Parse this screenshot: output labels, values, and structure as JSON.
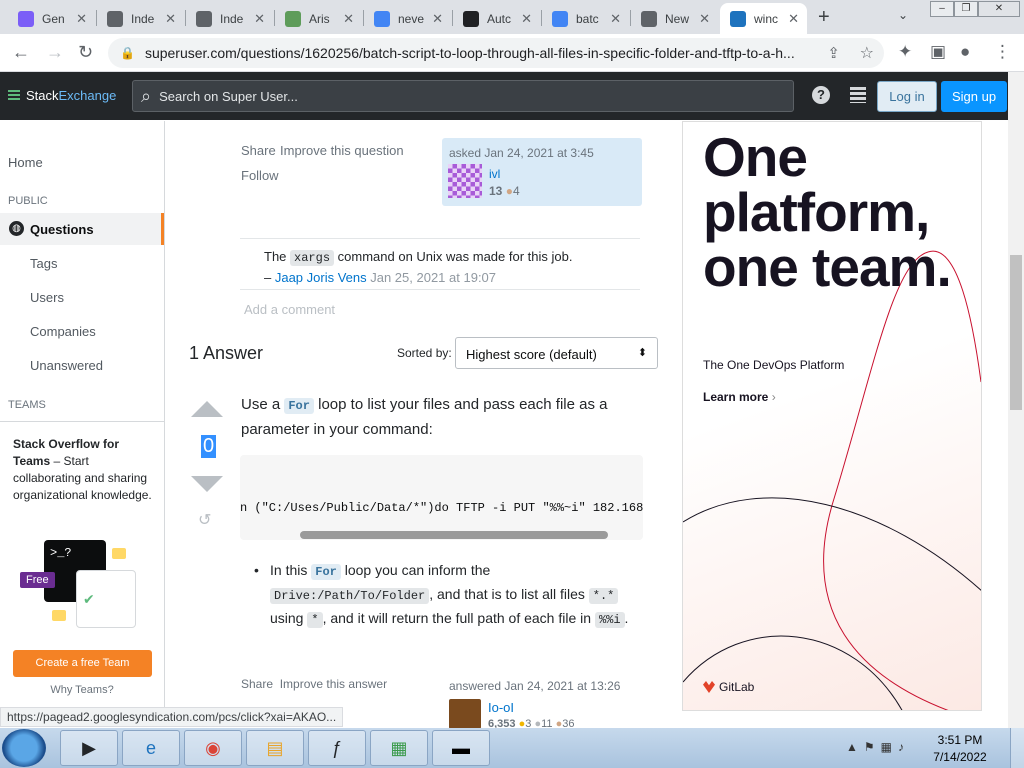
{
  "tabs": [
    {
      "title": "Gen",
      "icon": "gemini-icon",
      "color": "#7b5ef7"
    },
    {
      "title": "Inde",
      "icon": "globe-icon",
      "color": "#5f6368"
    },
    {
      "title": "Inde",
      "icon": "globe-icon",
      "color": "#5f6368"
    },
    {
      "title": "Aris",
      "icon": "leaf-icon",
      "color": "#5e9c5a"
    },
    {
      "title": "neve",
      "icon": "google-icon",
      "color": "#4285f4"
    },
    {
      "title": "Autc",
      "icon": "a-icon",
      "color": "#202124"
    },
    {
      "title": "batc",
      "icon": "google-icon",
      "color": "#4285f4"
    },
    {
      "title": "New",
      "icon": "chrome-icon",
      "color": "#5f6368"
    },
    {
      "title": "winc",
      "icon": "superuser-icon",
      "color": "#1e73be"
    }
  ],
  "address": {
    "url": "superuser.com/questions/1620256/batch-script-to-loop-through-all-files-in-specific-folder-and-tftp-to-a-h..."
  },
  "header": {
    "logo_a": "Stack",
    "logo_b": "Exchange",
    "search_placeholder": "Search on Super User...",
    "login": "Log in",
    "signup": "Sign up"
  },
  "sidebar": {
    "home": "Home",
    "public": "PUBLIC",
    "questions": "Questions",
    "tags": "Tags",
    "users": "Users",
    "companies": "Companies",
    "unanswered": "Unanswered",
    "teams_heading": "TEAMS",
    "teams_title": "Stack Overflow for Teams",
    "teams_text": " – Start collaborating and sharing organizational knowledge.",
    "badge_free": "Free",
    "prompt": ">_?",
    "create_team": "Create a free Team",
    "why_teams": "Why Teams?"
  },
  "question": {
    "share": "Share",
    "improve": "Improve this question",
    "follow": "Follow",
    "asked": "asked Jan 24, 2021 at 3:45",
    "user": "ivl",
    "rep": "13",
    "bronze": "4"
  },
  "comment": {
    "pre": "The ",
    "code": "xargs",
    "post": " command on Unix was made for this job.",
    "dash": "– ",
    "author": "Jaap Joris Vens",
    "date": " Jan 25, 2021 at 19:07",
    "add": "Add a comment"
  },
  "answers": {
    "heading": "1 Answer",
    "sorted_by": "Sorted by:",
    "sort_value": "Highest score (default)"
  },
  "answer": {
    "score": "0",
    "p1a": "Use a ",
    "p1kw": "For",
    "p1b": " loop to list your files and pass each file as a parameter in your command:",
    "code": "n (\"C:/Uses/Public/Data/*\")do TFTP -i PUT \"%%~i\" 182.168.",
    "b1a": "In this ",
    "b1kw": "For",
    "b1b": " loop you can inform the ",
    "b1c1": "Drive:/Path/To/Folder",
    "b1d": ", and that is to list all files ",
    "b1c2": "*.*",
    "b1e": " using ",
    "b1c3": "*",
    "b1f": ", and it will return the full path of each file in ",
    "b1c4": "%%i",
    "b1g": ".",
    "share": "Share",
    "improve": "Improve this answer",
    "answered": "answered Jan 24, 2021 at 13:26",
    "user": "Io-oI",
    "rep": "6,353",
    "gold": "3",
    "silver": "11",
    "bronze": "36"
  },
  "ad": {
    "headline": "One platform, one team.",
    "sub": "The One DevOps Platform",
    "learn": "Learn more",
    "brand": "GitLab"
  },
  "status_url": "https://pagead2.googlesyndication.com/pcs/click?xai=AKAO...",
  "clock": {
    "time": "3:51 PM",
    "date": "7/14/2022"
  }
}
